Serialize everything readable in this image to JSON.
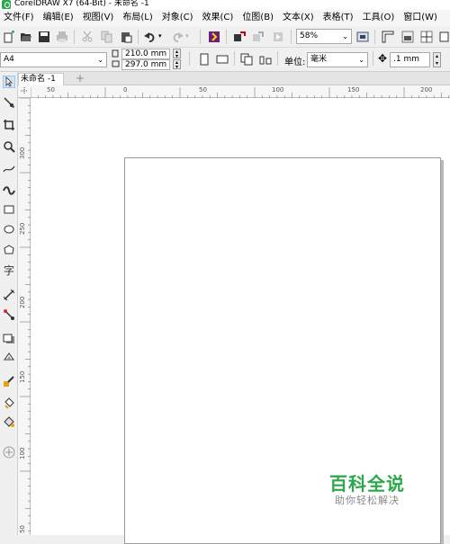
{
  "window": {
    "title": "CorelDRAW X7 (64-Bit) - 未命名 -1"
  },
  "menu": [
    "文件(F)",
    "编辑(E)",
    "视图(V)",
    "布局(L)",
    "对象(C)",
    "效果(C)",
    "位图(B)",
    "文本(X)",
    "表格(T)",
    "工具(O)",
    "窗口(W)"
  ],
  "toolbar": {
    "zoom": "58%"
  },
  "propbar": {
    "page_size": "A4",
    "width": "210.0 mm",
    "height": "297.0 mm",
    "units_label": "单位:",
    "units_value": "毫米",
    "nudge": ".1 mm"
  },
  "tabs": {
    "doc_tab": "未命名 -1",
    "add": "+"
  },
  "ruler_h": [
    "50",
    "0",
    "50",
    "100",
    "150",
    "200"
  ],
  "ruler_v": [
    "300",
    "250",
    "200",
    "150",
    "100",
    "50"
  ],
  "watermark": {
    "brand": "百科全说",
    "slogan": "助你轻松解决"
  },
  "colors": {
    "accent": "#2aa84a",
    "canvas": "#ffffff",
    "chrome": "#f0f0f0"
  }
}
